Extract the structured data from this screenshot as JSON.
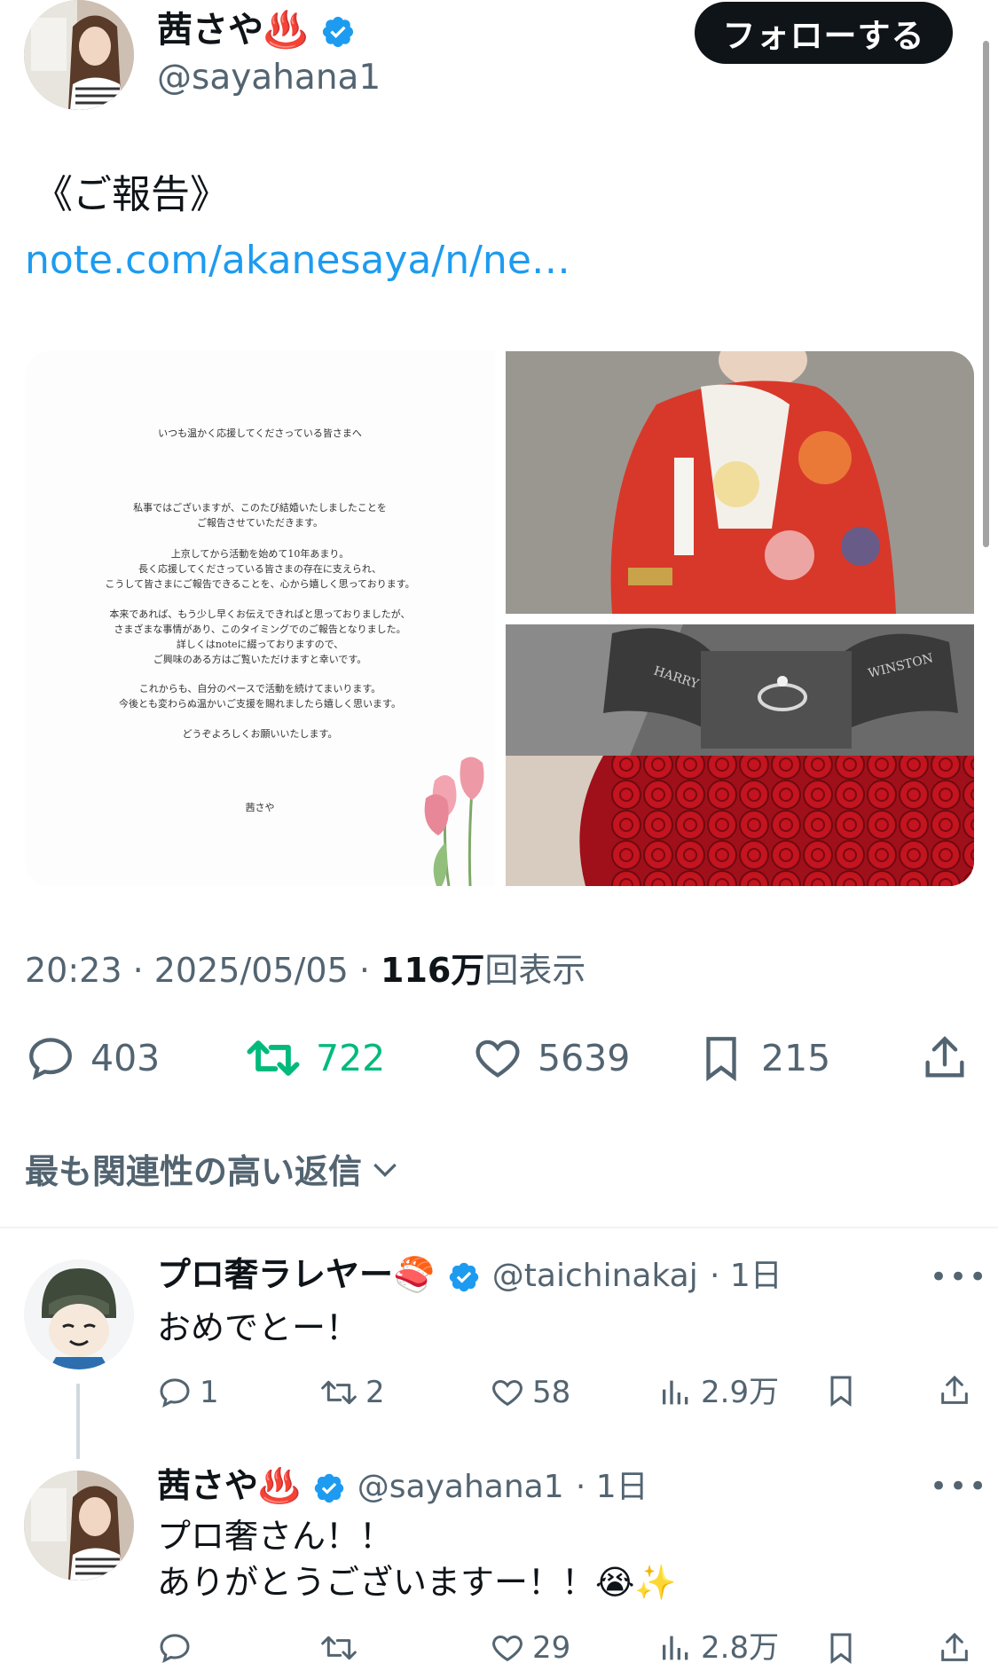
{
  "tweet": {
    "author_name": "茜さや♨️",
    "author_handle": "@sayahana1",
    "follow_label": "フォローする",
    "text": "《ご報告》",
    "link": "note.com/akanesaya/n/ne…",
    "meta_time": "20:23 · 2025/05/05 · ",
    "views_count": "116万",
    "views_label": "回表示",
    "replies": "403",
    "retweets": "722",
    "likes": "5639",
    "bookmarks": "215",
    "photo_letter": {
      "lines": [
        "いつも温かく応援してくださっている皆さまへ",
        "私事ではございますが、このたび結婚いたしましたことを",
        "ご報告させていただきます。",
        "上京してから活動を始めて10年あまり。",
        "長く応援してくださっている皆さまの存在に支えられ、",
        "こうして皆さまにご報告できることを、心から嬉しく思っております。",
        "本来であれば、もう少し早くお伝えできればと思っておりましたが、",
        "さまざまな事情があり、このタイミングでのご報告となりました。",
        "詳しくはnoteに綴っておりますので、",
        "ご興味のある方はご覧いただけますと幸いです。",
        "これからも、自分のペースで活動を続けてまいります。",
        "今後とも変わらぬ温かいご支援を賜れましたら嬉しく思います。",
        "どうぞよろしくお願いいたします。",
        "茜さや"
      ],
      "ring_box_left": "HARRY",
      "ring_box_right": "WINSTON"
    }
  },
  "sort_label": "最も関連性の高い返信",
  "replies": [
    {
      "name": "プロ奢ラレヤー🍣",
      "handle": "@taichinakaj",
      "time": "· 1日",
      "text": [
        "おめでとー！"
      ],
      "stats": {
        "replies": "1",
        "retweets": "2",
        "likes": "58",
        "views": "2.9万"
      }
    },
    {
      "name": "茜さや♨️",
      "handle": "@sayahana1",
      "time": "· 1日",
      "text": [
        "プロ奢さん！！",
        "ありがとうございますー！！😭✨"
      ],
      "stats": {
        "replies": "",
        "retweets": "",
        "likes": "29",
        "views": "2.8万"
      }
    }
  ],
  "colors": {
    "link": "#1d9bf0",
    "retweet": "#00ba7c",
    "verified": "#1d9bf0",
    "muted": "#536471"
  }
}
